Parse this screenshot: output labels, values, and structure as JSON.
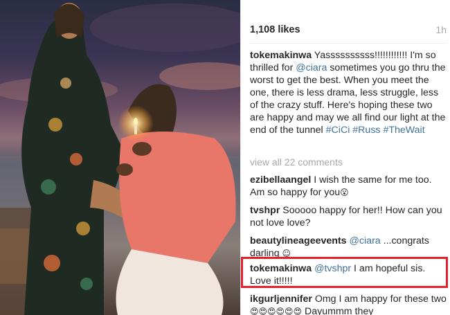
{
  "post": {
    "likes": "1,108 likes",
    "time": "1h"
  },
  "caption": {
    "user": "tokemakinwa",
    "text_1": " Yassssssssss!!!!!!!!!!!! I'm so thrilled for ",
    "mention": "@ciara",
    "text_2": " sometimes you go thru the worst to get the best. When you meet the one, there is less drama, less struggle, less of the crazy stuff. Here's hoping these two are happy and may we all find our light at the end of the tunnel ",
    "hashtag_1": "#CiCi",
    "hashtag_2": "#Russ",
    "hashtag_3": "#TheWait"
  },
  "view_all": "view all 22 comments",
  "comments": [
    {
      "user": "ezibellaangel",
      "text": " I wish the same for me too. Am so happy for you",
      "emoji": "😮"
    },
    {
      "user": "tvshpr",
      "text": " Sooooo happy for her!! How can you not love love?"
    },
    {
      "user": "beautylineageevents",
      "mention": "@ciara",
      "text": " ...congrats darling ",
      "emoji": "☺"
    },
    {
      "user": "tokemakinwa",
      "mention": "@tvshpr",
      "text": " I am hopeful sis. Love it!!!!!"
    },
    {
      "user": "ikgurljennifer",
      "text": " Omg I am happy for these two",
      "emoji": "😍😍😍😍😍😍",
      "text_2": " Dayummm they"
    }
  ],
  "colors": {
    "link": "#3f729b",
    "highlight_border": "#e8202c",
    "muted": "#a5a7aa"
  }
}
